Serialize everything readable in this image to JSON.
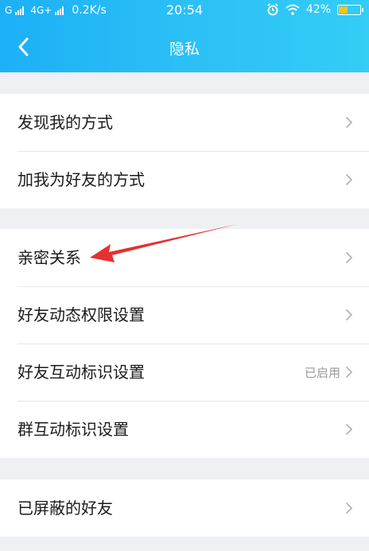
{
  "status_bar": {
    "carrier": "G",
    "network": "4G+",
    "speed": "0.2K/s",
    "time": "20:54",
    "battery": "42%",
    "battery_level": 0.42,
    "icons": [
      "signal-icon",
      "alarm-icon",
      "wifi-icon",
      "battery-icon"
    ]
  },
  "header": {
    "title": "隐私",
    "back_icon": "chevron-left-icon"
  },
  "groups": [
    {
      "items": [
        {
          "label": "发现我的方式"
        },
        {
          "label": "加我为好友的方式"
        }
      ]
    },
    {
      "items": [
        {
          "label": "亲密关系"
        },
        {
          "label": "好友动态权限设置"
        },
        {
          "label": "好友互动标识设置",
          "value": "已启用"
        },
        {
          "label": "群互动标识设置"
        }
      ]
    },
    {
      "items": [
        {
          "label": "已屏蔽的好友"
        }
      ]
    }
  ],
  "colors": {
    "header_gradient_start": "#1cb0f6",
    "header_gradient_end": "#33cdf6",
    "background": "#eff0f4",
    "annotation_arrow": "#e63131"
  }
}
